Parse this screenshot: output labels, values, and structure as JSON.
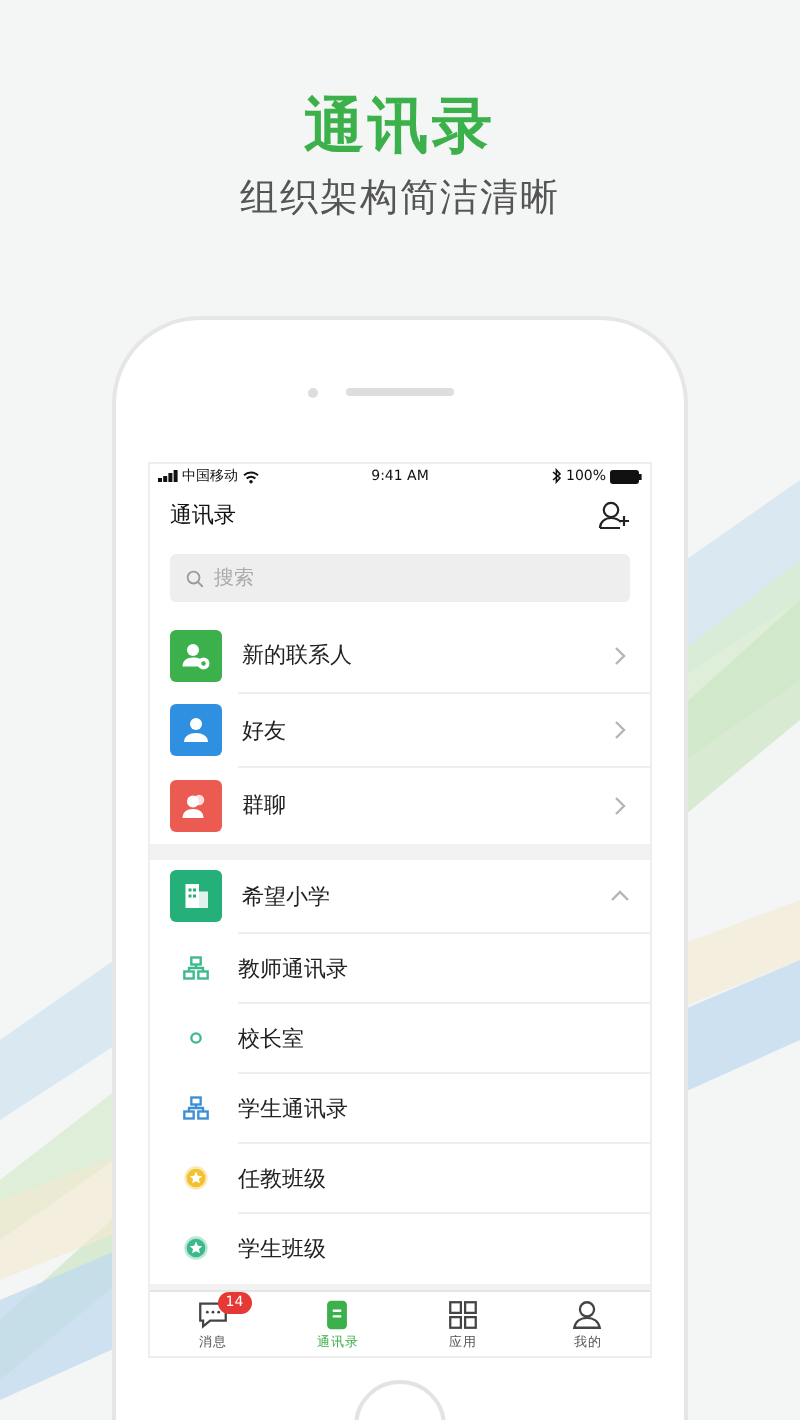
{
  "header": {
    "title": "通讯录",
    "subtitle": "组织架构简洁清晰"
  },
  "status_bar": {
    "carrier": "中国移动",
    "time": "9:41 AM",
    "battery": "100%"
  },
  "nav": {
    "title": "通讯录"
  },
  "search": {
    "placeholder": "搜索"
  },
  "entries": [
    {
      "label": "新的联系人",
      "kind": "add-person",
      "color": "#3cb04a"
    },
    {
      "label": "好友",
      "kind": "person",
      "color": "#2f8fe0"
    },
    {
      "label": "群聊",
      "kind": "group",
      "color": "#ec5b52"
    }
  ],
  "organization": {
    "name": "希望小学",
    "color": "#25b07a",
    "expanded": true,
    "children": [
      {
        "label": "教师通讯录",
        "kind": "org",
        "color": "#3cb98a"
      },
      {
        "label": "校长室",
        "kind": "dot",
        "color": "#3cb98a"
      },
      {
        "label": "学生通讯录",
        "kind": "org",
        "color": "#3a8fd6"
      },
      {
        "label": "任教班级",
        "kind": "star",
        "color": "#f2c12e"
      },
      {
        "label": "学生班级",
        "kind": "star",
        "color": "#3cb98a"
      }
    ]
  },
  "tabs": [
    {
      "label": "消息",
      "kind": "chat",
      "selected": false,
      "badge": "14"
    },
    {
      "label": "通讯录",
      "kind": "contacts",
      "selected": true
    },
    {
      "label": "应用",
      "kind": "apps",
      "selected": false
    },
    {
      "label": "我的",
      "kind": "profile",
      "selected": false
    }
  ]
}
